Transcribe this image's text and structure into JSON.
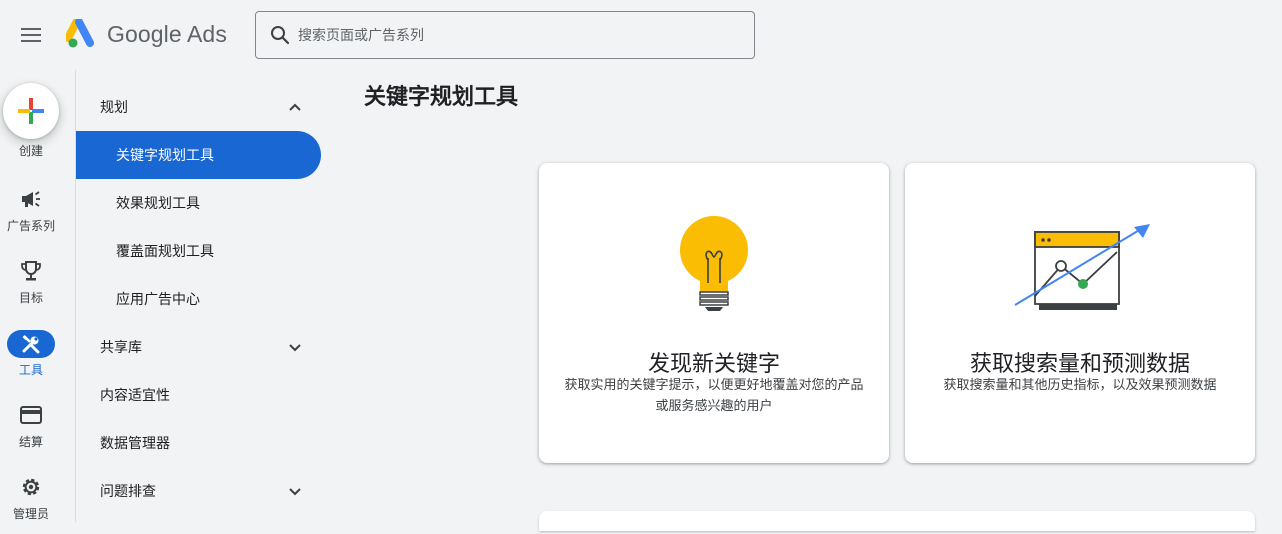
{
  "header": {
    "logo_text": "Google Ads",
    "search_placeholder": "搜索页面或广告系列"
  },
  "rail": {
    "create_label": "创建",
    "items": [
      {
        "label": "广告系列",
        "icon": "megaphone-icon"
      },
      {
        "label": "目标",
        "icon": "trophy-icon"
      },
      {
        "label": "工具",
        "icon": "tools-icon",
        "active": true
      },
      {
        "label": "结算",
        "icon": "credit-card-icon"
      },
      {
        "label": "管理员",
        "icon": "gear-icon"
      }
    ]
  },
  "sidenav": {
    "sections": [
      {
        "label": "规划",
        "expanded": true
      },
      {
        "label": "共享库",
        "expanded": false
      },
      {
        "label": "内容适宜性"
      },
      {
        "label": "数据管理器"
      },
      {
        "label": "问题排查",
        "expanded": false
      }
    ],
    "planning_items": [
      {
        "label": "关键字规划工具",
        "selected": true
      },
      {
        "label": "效果规划工具"
      },
      {
        "label": "覆盖面规划工具"
      },
      {
        "label": "应用广告中心"
      }
    ]
  },
  "main": {
    "title": "关键字规划工具",
    "cards": [
      {
        "title": "发现新关键字",
        "description": "获取实用的关键字提示，以便更好地覆盖对您的产品或服务感兴趣的用户",
        "icon": "lightbulb-icon"
      },
      {
        "title": "获取搜索量和预测数据",
        "description": "获取搜索量和其他历史指标，以及效果预测数据",
        "icon": "trend-chart-icon"
      }
    ]
  },
  "colors": {
    "accent": "#1967d2",
    "bulb_yellow": "#fbbc04",
    "google_blue": "#4285f4",
    "google_green": "#34a853",
    "google_red": "#ea4335"
  }
}
